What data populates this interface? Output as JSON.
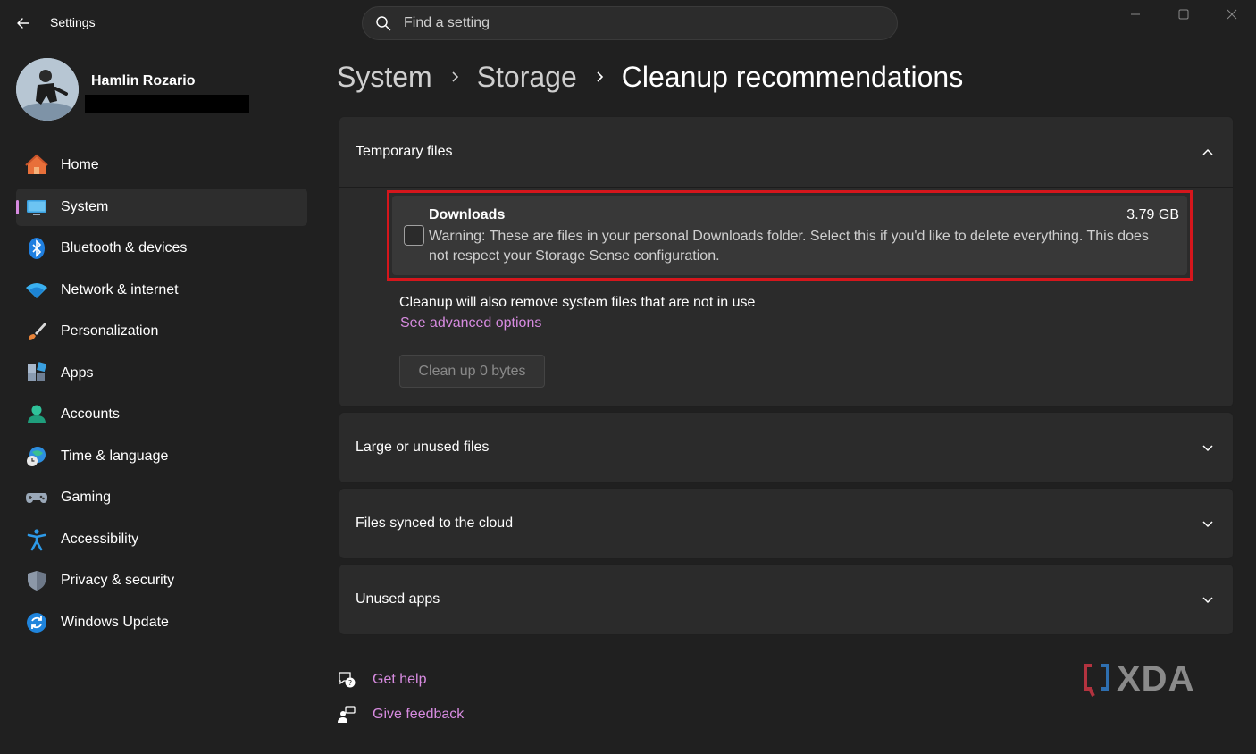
{
  "window": {
    "title": "Settings"
  },
  "search": {
    "placeholder": "Find a setting"
  },
  "profile": {
    "name": "Hamlin Rozario"
  },
  "sidebar": {
    "items": [
      {
        "label": "Home",
        "icon": "home-icon"
      },
      {
        "label": "System",
        "icon": "system-icon",
        "active": true
      },
      {
        "label": "Bluetooth & devices",
        "icon": "bluetooth-icon"
      },
      {
        "label": "Network & internet",
        "icon": "wifi-icon"
      },
      {
        "label": "Personalization",
        "icon": "brush-icon"
      },
      {
        "label": "Apps",
        "icon": "apps-icon"
      },
      {
        "label": "Accounts",
        "icon": "person-icon"
      },
      {
        "label": "Time & language",
        "icon": "globe-clock-icon"
      },
      {
        "label": "Gaming",
        "icon": "gamepad-icon"
      },
      {
        "label": "Accessibility",
        "icon": "accessibility-icon"
      },
      {
        "label": "Privacy & security",
        "icon": "shield-icon"
      },
      {
        "label": "Windows Update",
        "icon": "update-icon"
      }
    ]
  },
  "breadcrumb": [
    "System",
    "Storage",
    "Cleanup recommendations"
  ],
  "temporary_files": {
    "title": "Temporary files",
    "downloads": {
      "title": "Downloads",
      "size": "3.79 GB",
      "warning": "Warning: These are files in your personal Downloads folder. Select this if you'd like to delete everything. This does not respect your Storage Sense configuration.",
      "checked": false
    },
    "note": "Cleanup will also remove system files that are not in use",
    "advanced_link": "See advanced options",
    "cleanup_button": "Clean up 0 bytes"
  },
  "sections": [
    {
      "title": "Large or unused files"
    },
    {
      "title": "Files synced to the cloud"
    },
    {
      "title": "Unused apps"
    }
  ],
  "footer": {
    "help": "Get help",
    "feedback": "Give feedback"
  },
  "watermark": "XDA",
  "colors": {
    "accent": "#d78be0",
    "highlight": "#d5161c",
    "background": "#202020",
    "card": "#2b2b2b"
  }
}
